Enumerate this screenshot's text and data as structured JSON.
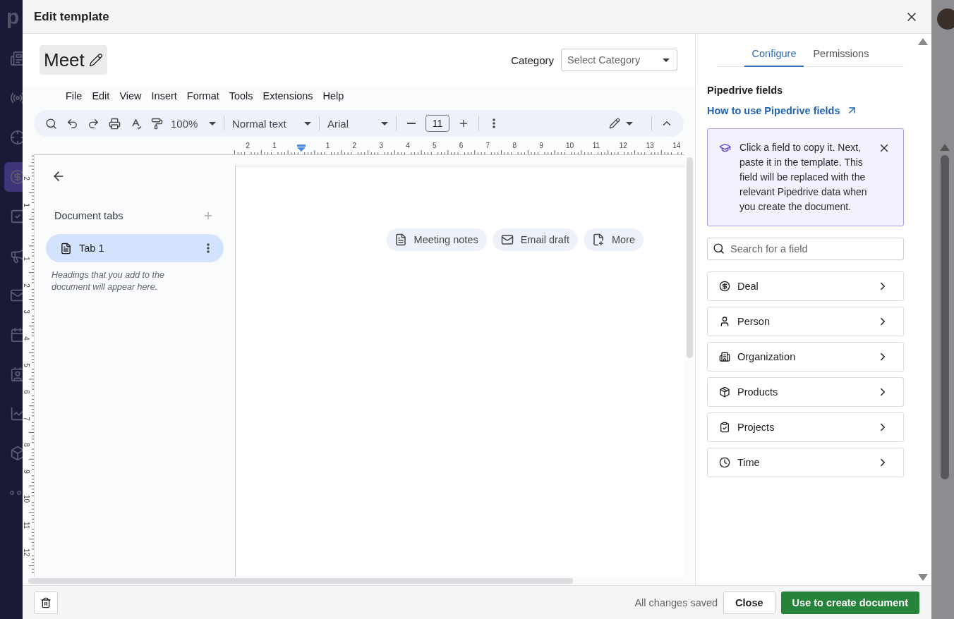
{
  "app_nav": {
    "logo": "p",
    "items": [
      {
        "selected": false
      },
      {
        "selected": false
      },
      {
        "selected": false
      },
      {
        "selected": true
      },
      {
        "selected": false
      },
      {
        "selected": false
      },
      {
        "selected": false
      },
      {
        "selected": false
      },
      {
        "selected": false
      },
      {
        "selected": false
      },
      {
        "selected": false
      },
      {
        "selected": false
      }
    ]
  },
  "modal": {
    "title": "Edit template"
  },
  "document": {
    "name": "Meet",
    "category_label": "Category",
    "category_placeholder": "Select Category"
  },
  "menu": [
    "File",
    "Edit",
    "View",
    "Insert",
    "Format",
    "Tools",
    "Extensions",
    "Help"
  ],
  "toolbar": {
    "zoom": "100%",
    "style": "Normal text",
    "font": "Arial",
    "font_size": "11"
  },
  "ruler": {
    "horizontal": [
      "2",
      "1",
      "1",
      "2",
      "3",
      "4",
      "5",
      "6",
      "7",
      "8",
      "9",
      "10",
      "11",
      "12",
      "13",
      "14"
    ],
    "vertical": [
      "2",
      "1",
      "1",
      "2",
      "3",
      "4",
      "5",
      "6",
      "7",
      "8",
      "9",
      "10",
      "11",
      "12"
    ]
  },
  "doc_tabs": {
    "title": "Document tabs",
    "tabs": [
      {
        "label": "Tab 1",
        "selected": true
      }
    ],
    "hint": "Headings that you add to the document will appear here."
  },
  "building_blocks": [
    {
      "kind": "notes",
      "label": "Meeting notes"
    },
    {
      "kind": "email",
      "label": "Email draft"
    },
    {
      "kind": "more",
      "label": "More"
    }
  ],
  "side_panel": {
    "tabs": [
      {
        "label": "Configure",
        "selected": true
      },
      {
        "label": "Permissions",
        "selected": false
      }
    ],
    "heading": "Pipedrive fields",
    "link": "How to use Pipedrive fields",
    "tip": "Click a field to copy it. Next, paste it in the template. This field will be replaced with the relevant Pipedrive data when you create the document.",
    "search_placeholder": "Search for a field",
    "fields": [
      {
        "kind": "deal",
        "label": "Deal"
      },
      {
        "kind": "person",
        "label": "Person"
      },
      {
        "kind": "organization",
        "label": "Organization"
      },
      {
        "kind": "products",
        "label": "Products"
      },
      {
        "kind": "projects",
        "label": "Projects"
      },
      {
        "kind": "time",
        "label": "Time"
      }
    ]
  },
  "footer": {
    "status": "All changes saved",
    "close": "Close",
    "primary": "Use to create document"
  }
}
